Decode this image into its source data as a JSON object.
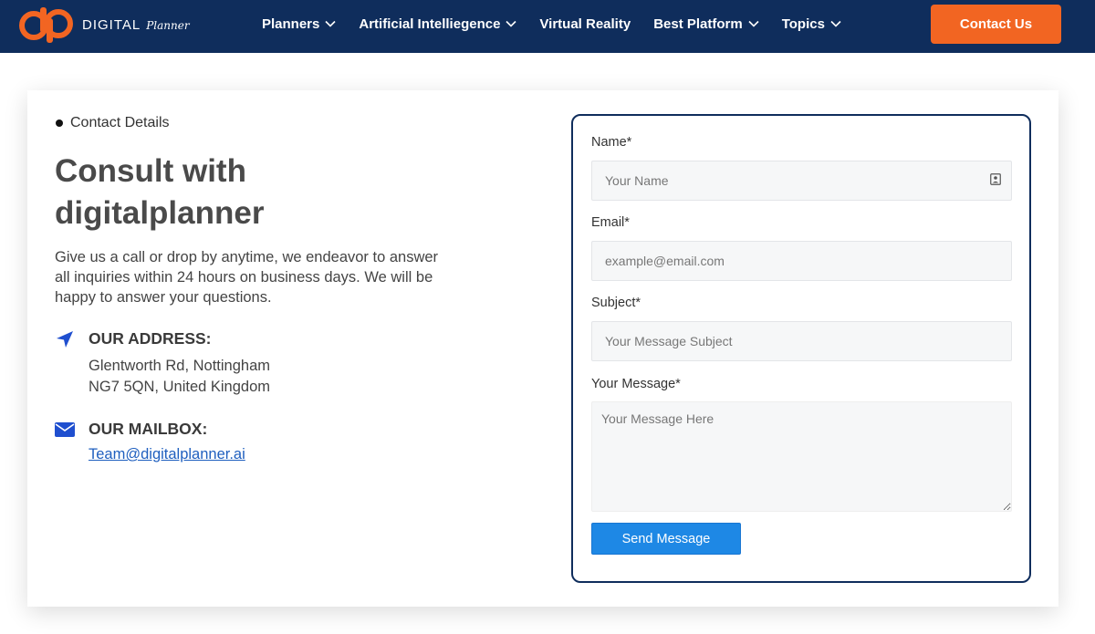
{
  "brand": {
    "word": "DIGITAL",
    "sub": "Planner",
    "logo_colors": {
      "primary": "#f26522",
      "background": "#0f2d5c"
    }
  },
  "nav": {
    "items": [
      {
        "label": "Planners",
        "has_dropdown": true
      },
      {
        "label": "Artificial Intelliegence",
        "has_dropdown": true
      },
      {
        "label": "Virtual Reality",
        "has_dropdown": false
      },
      {
        "label": "Best Platform",
        "has_dropdown": true
      },
      {
        "label": "Topics",
        "has_dropdown": true
      }
    ],
    "cta_label": "Contact Us"
  },
  "contact": {
    "eyebrow": "Contact Details",
    "headline": "Consult with digitalplanner",
    "lead": "Give us a call or drop by anytime, we endeavor to answer all inquiries within 24 hours on business days. We will be happy to answer your questions.",
    "address": {
      "icon": "location-arrow-icon",
      "title": "OUR ADDRESS:",
      "line1": "Glentworth Rd, Nottingham",
      "line2": "NG7 5QN, United Kingdom"
    },
    "mailbox": {
      "icon": "envelope-icon",
      "title": "OUR MAILBOX:",
      "email": "Team@digitalplanner.ai"
    }
  },
  "form": {
    "name_label": "Name*",
    "name_placeholder": "Your Name",
    "email_label": "Email*",
    "email_placeholder": "example@email.com",
    "subject_label": "Subject*",
    "subject_placeholder": "Your Message Subject",
    "message_label": "Your Message*",
    "message_placeholder": "Your Message Here",
    "submit_label": "Send Message"
  },
  "colors": {
    "header_bg": "#0f2d5c",
    "accent_orange": "#f26522",
    "button_blue": "#1e88e5",
    "icon_blue": "#1f4fcf",
    "link_blue": "#1f5fbf"
  }
}
